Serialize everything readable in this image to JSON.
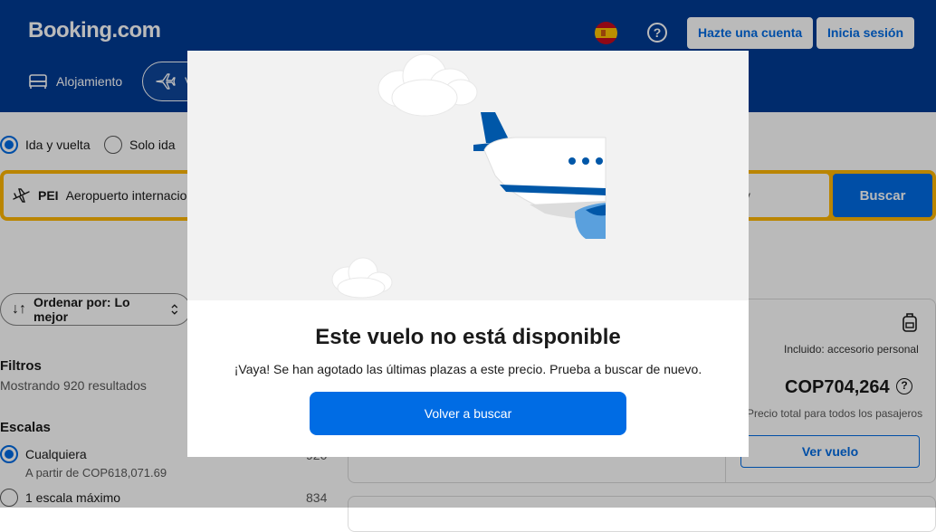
{
  "header": {
    "logo": "Booking.com",
    "create_account": "Hazte una cuenta",
    "sign_in": "Inicia sesión",
    "tabs": [
      {
        "label": "Alojamiento",
        "icon": "bed-icon"
      },
      {
        "label": "V",
        "icon": "plane-icon"
      }
    ]
  },
  "trip_type": {
    "round_trip": "Ida y vuelta",
    "one_way": "Solo ida",
    "selected": "round_trip"
  },
  "search": {
    "origin_code": "PEI",
    "origin_name": "Aeropuerto internacio",
    "partial_field_text": "v",
    "search_button": "Buscar"
  },
  "sort": {
    "label": "Ordenar por: Lo mejor"
  },
  "filters": {
    "title": "Filtros",
    "results_count": "Mostrando 920 resultados",
    "stops_title": "Escalas",
    "options": [
      {
        "label": "Cualquiera",
        "sub": "A partir de COP618,071.69",
        "count": "920",
        "selected": true
      },
      {
        "label": "1 escala máximo",
        "sub": "",
        "count": "834",
        "selected": false
      }
    ]
  },
  "result_card": {
    "baggage_label": "Incluido: accesorio personal",
    "price": "COP704,264",
    "price_note": "Precio total para todos los pasajeros",
    "view_button": "Ver vuelo"
  },
  "modal": {
    "title": "Este vuelo no está disponible",
    "message": "¡Vaya! Se han agotado las últimas plazas a este precio. Prueba a buscar de nuevo.",
    "button": "Volver a buscar"
  },
  "colors": {
    "brand_blue": "#003b95",
    "action_blue": "#006ce4",
    "search_yellow": "#ffb700"
  }
}
